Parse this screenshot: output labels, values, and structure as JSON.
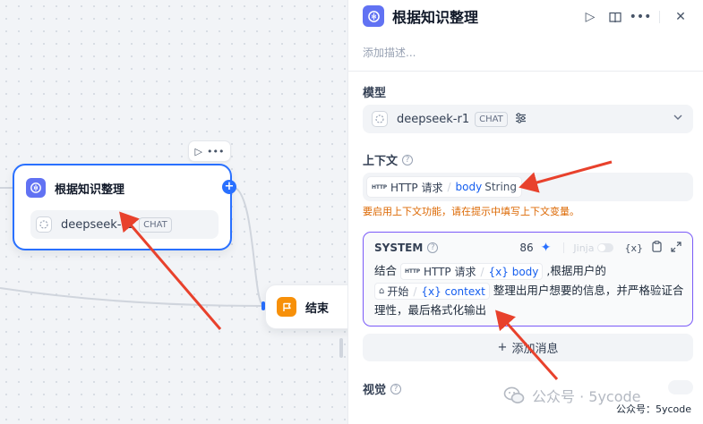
{
  "canvas": {
    "llm_node": {
      "title": "根据知识整理",
      "model": "deepseek-r1",
      "model_tag": "CHAT"
    },
    "end_node": {
      "title": "结束"
    }
  },
  "panel": {
    "title": "根据知识整理",
    "description_placeholder": "添加描述...",
    "model_label": "模型",
    "model": {
      "name": "deepseek-r1",
      "tag": "CHAT"
    },
    "context_label": "上下文",
    "context_chip": {
      "source_badge": "HTTP",
      "source": "HTTP 请求",
      "separator": "/",
      "key": "body",
      "type": "String"
    },
    "context_warning": "要启用上下文功能，请在提示中填写上下文变量。",
    "system_prompt": {
      "role": "SYSTEM",
      "token_count": "86",
      "jinja_label": "Jinja",
      "var_label": "{x}",
      "text_1": "结合",
      "var1_source": "HTTP 请求",
      "var1_key": "{x} body",
      "text_2": ",根据用户的",
      "var2_source": "开始",
      "var2_key": "{x} context",
      "text_3": "整理出用户想要的信息，并严格验证合理性，最后格式化输出"
    },
    "add_message_label": "添加消息",
    "vision_label": "视觉"
  },
  "watermark": {
    "text": "公众号 · 5ycode"
  },
  "credit": "公众号：5ycode",
  "colors": {
    "accent": "#2970ff",
    "llm_icon": "#6172f3",
    "end_icon": "#f79009",
    "prompt_border": "#7a5af8",
    "warning": "#dc6803",
    "annotation": "#e8412c"
  }
}
